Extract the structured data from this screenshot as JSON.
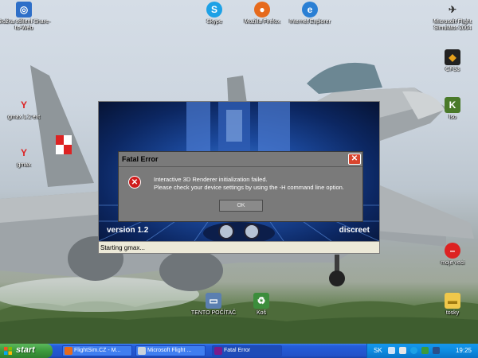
{
  "desktop": {
    "icons": [
      {
        "label": "Složka sdílení Share-to-Web",
        "icon": "folder-share-icon"
      },
      {
        "label": "Skype",
        "icon": "skype-icon"
      },
      {
        "label": "Mozilla Firefox",
        "icon": "firefox-icon"
      },
      {
        "label": "Internet Explorer",
        "icon": "ie-icon"
      },
      {
        "label": "Microsoft Flight Simulator 2004",
        "icon": "flight-sim-icon"
      },
      {
        "label": "CFS3",
        "icon": "cfs3-icon"
      },
      {
        "label": "gmax 1.2 ext",
        "icon": "gmax-icon"
      },
      {
        "label": "gmax",
        "icon": "gmax-icon"
      },
      {
        "label": "Iso",
        "icon": "iso-icon"
      },
      {
        "label": "moje veci",
        "icon": "no-entry-icon"
      },
      {
        "label": "TENTO POČÍTAČ",
        "icon": "computer-icon"
      },
      {
        "label": "Koš",
        "icon": "recycle-bin-icon"
      },
      {
        "label": "tosky",
        "icon": "folder-icon"
      }
    ]
  },
  "splash": {
    "version": "version 1.2",
    "brand": "discreet",
    "status": "Starting gmax..."
  },
  "dialog": {
    "title": "Fatal Error",
    "close": "✕",
    "line1": "Interactive 3D Renderer initialization failed.",
    "line2": "Please check your device settings by using the -H command line option.",
    "ok": "OK"
  },
  "taskbar": {
    "start": "start",
    "tasks": [
      {
        "label": "FlightSim.CZ - M...",
        "icon": "firefox-icon"
      },
      {
        "label": "Microsoft Flight ...",
        "icon": "flight-sim-icon"
      },
      {
        "label": "Fatal Error",
        "icon": "gmax-icon"
      }
    ],
    "language": "SK",
    "clock": "19:25"
  },
  "colors": {
    "taskbar_blue": "#245edb",
    "start_green": "#3c9a3c",
    "dialog_gray": "#7a7a7a",
    "error_red": "#cf1c1c"
  }
}
